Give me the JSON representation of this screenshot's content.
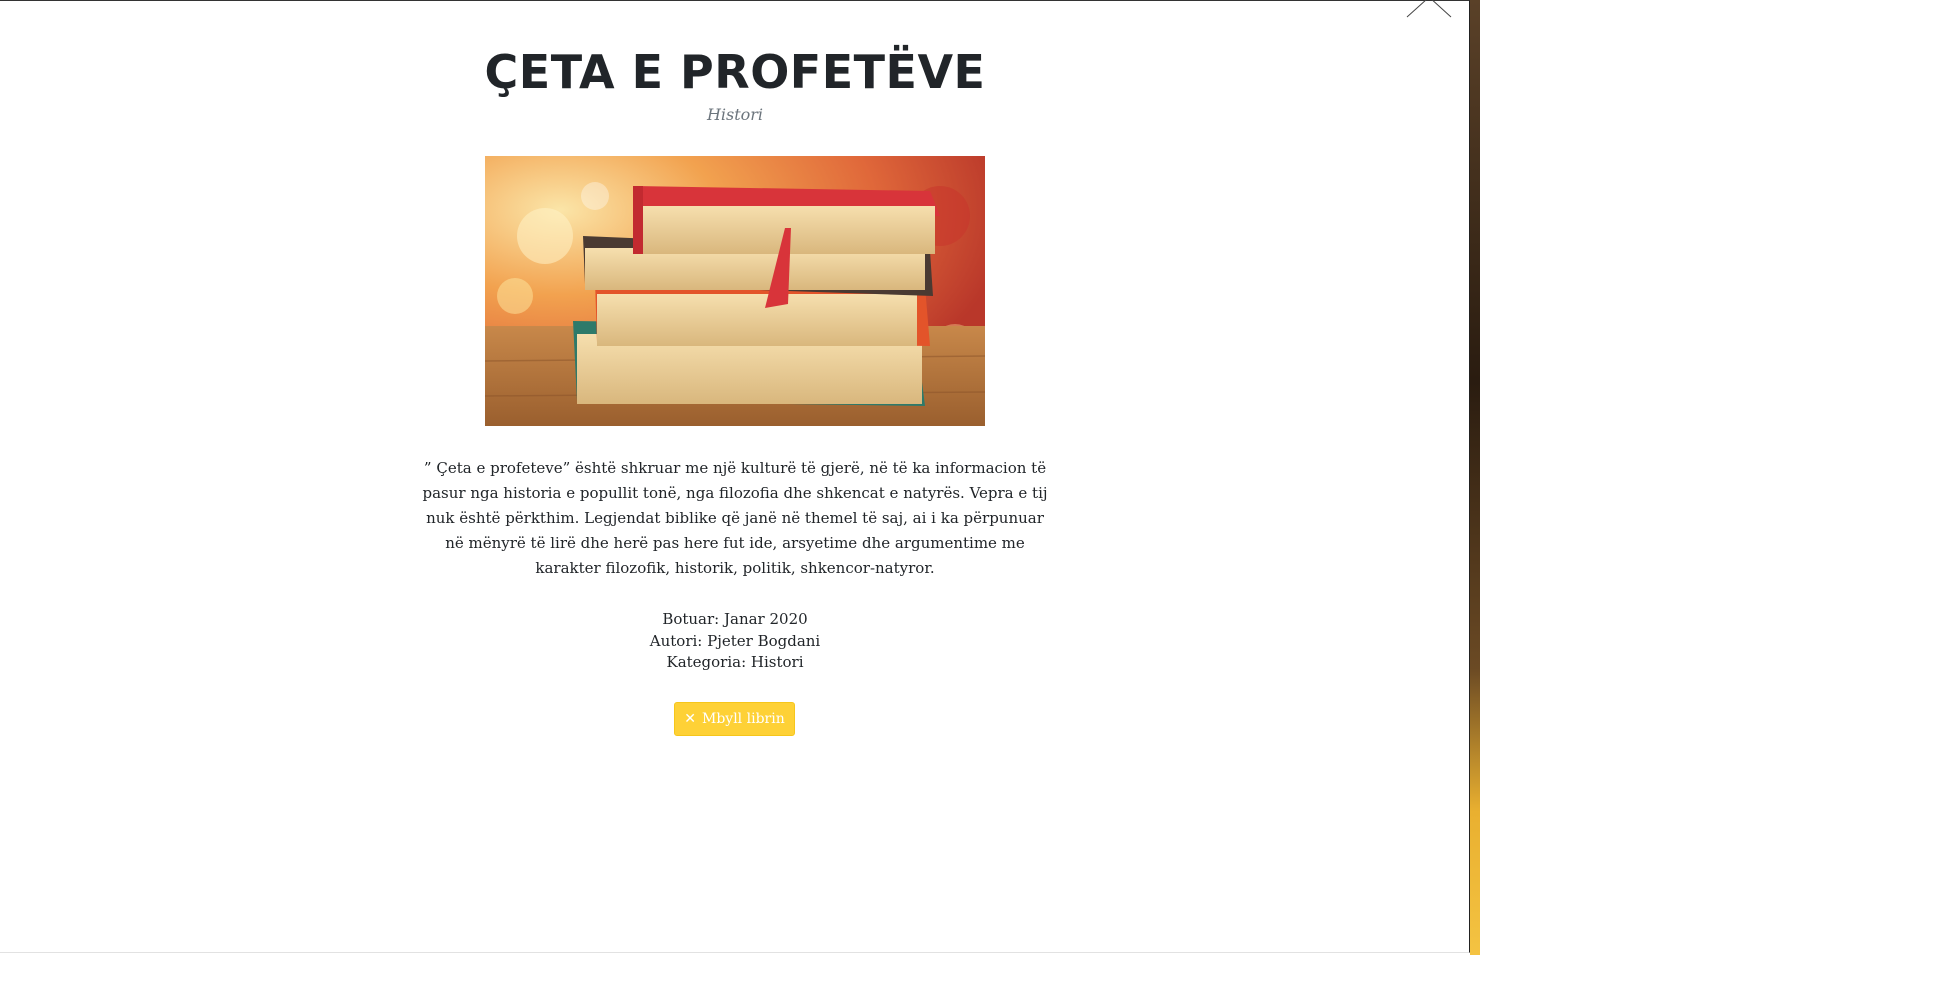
{
  "modal": {
    "title": "ÇETA E PROFETËVE",
    "subtitle": "Histori",
    "image_alt": "Stack of books on wooden table",
    "description": "” Çeta e profeteve” është shkruar me një kulturë të gjerë, në të ka informacion të pasur nga historia e popullit tonë, nga filozofia dhe shkencat e natyrës. Vepra e tij nuk është përkthim. Legjendat biblike që janë në themel të saj, ai i ka përpunuar në mënyrë të lirë dhe herë pas here fut ide, arsyetime dhe argumentime me karakter filozofik, historik, politik, shkencor-natyror.",
    "meta": {
      "published": "Botuar: Janar 2020",
      "author": "Autori: Pjeter Bogdani",
      "category": "Kategoria: Histori"
    },
    "close_button_label": "Mbyll librin",
    "close_icon": "close-x-icon",
    "accent_color": "#fed136"
  }
}
